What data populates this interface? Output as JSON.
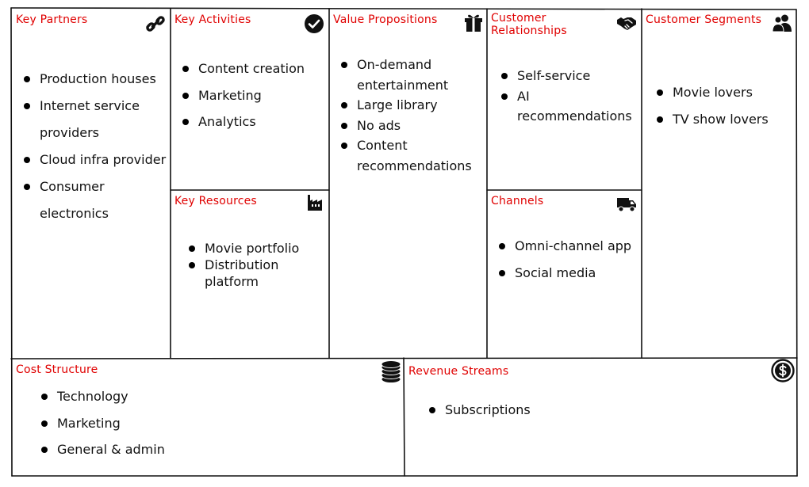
{
  "canvas": {
    "key_partners": {
      "title": "Key Partners",
      "icon": "link-icon",
      "items": [
        "Production houses",
        "Internet service providers",
        "Cloud infra provider",
        "Consumer electronics"
      ]
    },
    "key_activities": {
      "title": "Key Activities",
      "icon": "check-circle-icon",
      "items": [
        "Content creation",
        "Marketing",
        "Analytics"
      ]
    },
    "key_resources": {
      "title": "Key Resources",
      "icon": "factory-icon",
      "items": [
        "Movie portfolio",
        "Distribution platform"
      ]
    },
    "value_propositions": {
      "title": "Value Propositions",
      "icon": "gift-icon",
      "items": [
        "On-demand entertainment",
        "Large library",
        "No ads",
        "Content recommendations"
      ]
    },
    "customer_relationships": {
      "title": "Customer Relationships",
      "icon": "handshake-icon",
      "items": [
        "Self-service",
        "AI recommendations"
      ]
    },
    "channels": {
      "title": "Channels",
      "icon": "truck-icon",
      "items": [
        "Omni-channel app",
        "Social media"
      ]
    },
    "customer_segments": {
      "title": "Customer Segments",
      "icon": "users-icon",
      "items": [
        "Movie lovers",
        "TV show lovers"
      ]
    },
    "cost_structure": {
      "title": "Cost Structure",
      "icon": "coins-icon",
      "items": [
        "Technology",
        "Marketing",
        "General & admin"
      ]
    },
    "revenue_streams": {
      "title": "Revenue Streams",
      "icon": "dollar-circle-icon",
      "items": [
        "Subscriptions"
      ]
    }
  },
  "colors": {
    "title": "#e00000",
    "border": "#111111",
    "text": "#111111"
  }
}
